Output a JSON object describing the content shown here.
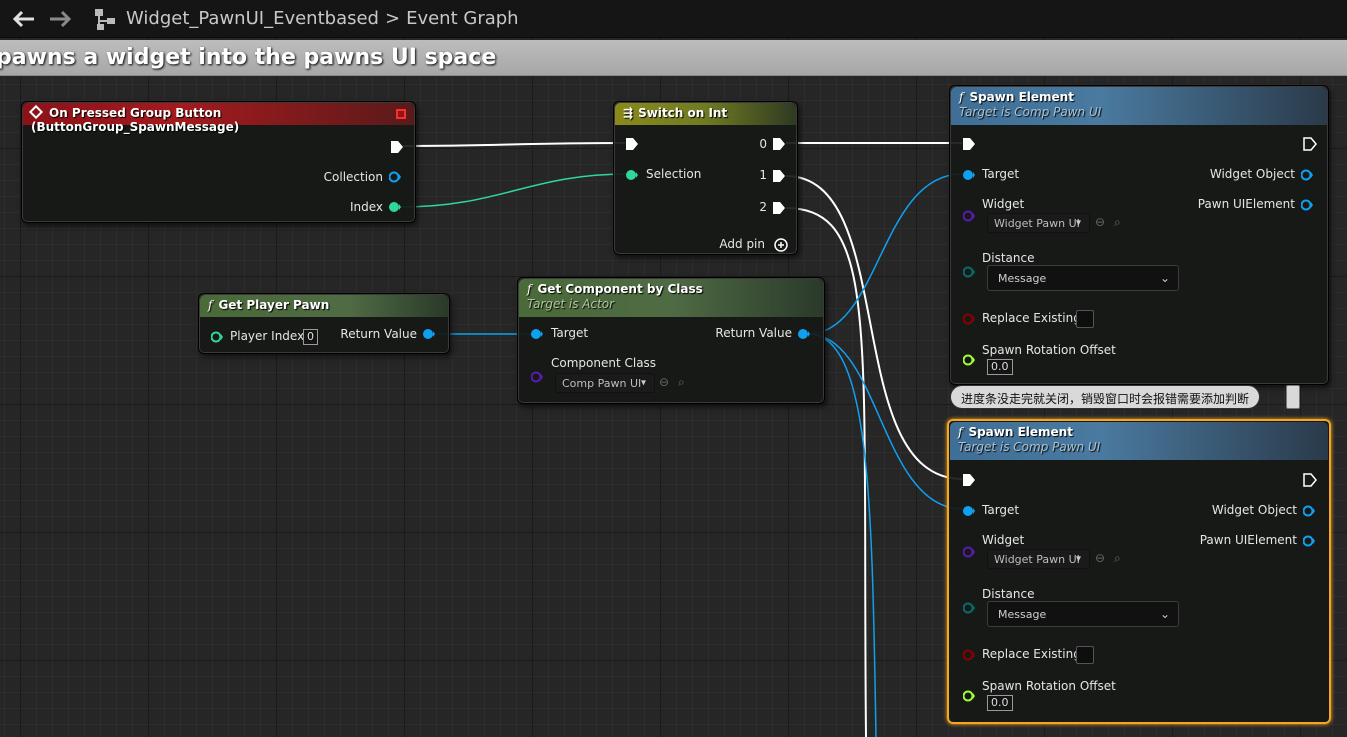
{
  "breadcrumb": {
    "blueprint": "Widget_PawnUI_Eventbased",
    "separator": ">",
    "graph": "Event Graph"
  },
  "banner_text": "pawns a widget into the pawns UI space",
  "colors": {
    "exec": "#ffffff",
    "object_pin": "#0fa0f0",
    "int_pin": "#2fd79a",
    "class_pin": "#5a1ab4",
    "bool_pin": "#8c0000",
    "vector_pin": "#9efc3a",
    "selection": "#f5a623"
  },
  "nodes": {
    "event": {
      "title": "On Pressed Group Button (ButtonGroup_SpawnMessage)",
      "icon": "event-diamond-icon",
      "outputs": [
        "Collection",
        "Index"
      ]
    },
    "switch": {
      "title": "Switch on Int",
      "icon": "switch-icon",
      "input": "Selection",
      "outputs": [
        "0",
        "1",
        "2"
      ],
      "add_pin": "Add pin"
    },
    "get_player_pawn": {
      "title": "Get Player Pawn",
      "input_label": "Player Index",
      "input_value": "0",
      "output": "Return Value"
    },
    "get_component": {
      "title": "Get Component by Class",
      "subtitle": "Target is Actor",
      "target": "Target",
      "class_label": "Component Class",
      "class_value": "Comp Pawn UI",
      "output": "Return Value"
    },
    "spawn1": {
      "title": "Spawn Element",
      "subtitle": "Target is Comp Pawn UI",
      "target": "Target",
      "widget_label": "Widget",
      "widget_value": "Widget Pawn UI",
      "distance_label": "Distance",
      "distance_value": "Message",
      "replace_label": "Replace Existing",
      "rotation_label": "Spawn Rotation Offset",
      "rotation_value": "0.0",
      "out_widget": "Widget Object",
      "out_element": "Pawn UIElement"
    },
    "spawn2": {
      "title": "Spawn Element",
      "subtitle": "Target is Comp Pawn UI",
      "target": "Target",
      "widget_label": "Widget",
      "widget_value": "Widget Pawn UI",
      "distance_label": "Distance",
      "distance_value": "Message",
      "replace_label": "Replace Existing",
      "rotation_label": "Spawn Rotation Offset",
      "rotation_value": "0.0",
      "out_widget": "Widget Object",
      "out_element": "Pawn UIElement"
    }
  },
  "comment": "进度条没走完就关闭，销毁窗口时会报错需要添加判断"
}
